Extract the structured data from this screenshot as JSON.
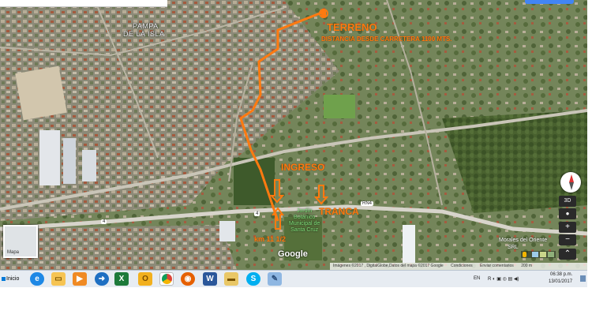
{
  "map": {
    "places": {
      "pampa_line1": "PAMPA",
      "pampa_line2": "DE LA ISLA",
      "morales_line1": "Morales del Oriente",
      "morales_line2": "SRL",
      "zoo_line1": "Jardín",
      "zoo_line2": "Botánico",
      "zoo_line3": "Municipal de",
      "zoo_line4": "Santa Cruz"
    },
    "annotations": {
      "terreno": "TERRENO",
      "distancia": "DISTANCIA DESDE CARRETERA 1100 MTS.",
      "ingreso": "INGRESO",
      "tranca": "TRANCA",
      "km": "km 11 1/2"
    },
    "road_labels": {
      "rn4": "RN4",
      "route_a": "4",
      "route_b": "4"
    },
    "logo": "Google",
    "attribution": {
      "imagery": "Imágenes ©2017 , DigitalGlobe,Datos del mapa ©2017 Google",
      "conditions": "Condiciones",
      "send": "Enviar comentarios",
      "scale": "200 m"
    },
    "controls": {
      "view3d": "3D",
      "zoom_in": "+",
      "zoom_out": "−",
      "expand": "⌃"
    },
    "minimap_label": "Mapa",
    "colors": {
      "annotation": "#ff7a10",
      "green_label": "#7fe07a"
    }
  },
  "taskbar": {
    "start_label": "Inicio",
    "apps": [
      "internet-explorer",
      "file-explorer",
      "media-player",
      "app-arrow",
      "excel",
      "outlook",
      "chrome",
      "firefox",
      "word",
      "folder",
      "skype",
      "paint"
    ],
    "lang": "EN",
    "clock_time": "06:38 p.m.",
    "clock_date": "13/01/2017"
  }
}
